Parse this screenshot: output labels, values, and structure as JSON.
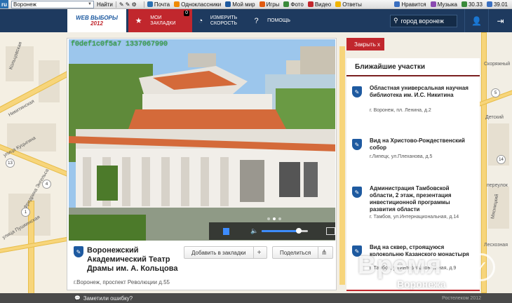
{
  "browser_toolbar": {
    "ru_label": "ru",
    "search_value": "Воронеж",
    "find_label": "Найти",
    "items": [
      {
        "label": "Почта",
        "icon": "mail-icon",
        "color": "#2a6fb0"
      },
      {
        "label": "Одноклассники",
        "icon": "ok-icon",
        "color": "#f08a00"
      },
      {
        "label": "Мой мир",
        "icon": "mymir-icon",
        "color": "#1e5aa0"
      },
      {
        "label": "Игры",
        "icon": "games-icon",
        "color": "#e05a10"
      },
      {
        "label": "Фото",
        "icon": "photo-icon",
        "color": "#3a8a3a"
      },
      {
        "label": "Видео",
        "icon": "video-icon",
        "color": "#c1272d"
      },
      {
        "label": "Ответы",
        "icon": "answers-icon",
        "color": "#f0b400"
      }
    ],
    "right_items": [
      {
        "label": "Нравится",
        "icon": "like-icon",
        "color": "#3a6fc0"
      },
      {
        "label": "Музыка",
        "icon": "music-icon",
        "color": "#8a4ab0"
      },
      {
        "label": "30.33",
        "icon": "dollar-icon",
        "color": "#3a8a3a"
      },
      {
        "label": "39.01",
        "icon": "euro-icon",
        "color": "#3a6fc0"
      }
    ]
  },
  "header": {
    "logo_line1": "WEB ВЫБОРЫ",
    "logo_line2": "2012",
    "bookmarks_label": "МОИ ЗАКЛАДКИ",
    "bookmarks_count": "0",
    "speed_label": "ИЗМЕРИТЬ СКОРОСТЬ",
    "help_label": "ПОМОЩЬ",
    "search_value": "город воронеж"
  },
  "video": {
    "camera_id": "f0def1c0f5a7 1337067990",
    "volume_level": 0.8
  },
  "place": {
    "title": "Воронежский Академический Театр Драмы им. А. Кольцова",
    "address": "г.Воронеж, проспект Революции д.55",
    "add_bookmark_label": "Добавить в закладки",
    "add_bookmark_icon": "+",
    "share_label": "Поделиться"
  },
  "side": {
    "close_label": "Закрыть  x",
    "heading": "Ближайшие участки",
    "items": [
      {
        "name": "Областная универсальная научная библиотека им. И.С. Никитина",
        "address": "г. Воронеж, пл. Ленина, д.2"
      },
      {
        "name": "Вид на Христово-Рождественский собор",
        "address": "г.Липецк, ул.Плеханова, д.5"
      },
      {
        "name": "Администрация Тамбовской области, 2 этаж, презентация инвестиционной программы развития области",
        "address": "г. Тамбов, ул.Интернациональная, д.14"
      },
      {
        "name": "Вид на сквер, строящуюся колокольню Казанского монастыря",
        "address": "г. Тамбов, ул.Интернациональная, д.9"
      }
    ]
  },
  "map_labels": [
    "Кольцовская",
    "Никитинская",
    "улица Куцыгина",
    "Фридриха Энгельса",
    "улица Пушкинская",
    "Скоряжный",
    "Детский",
    "Мясницкий",
    "переулок",
    "Лесхозная"
  ],
  "footer": {
    "feedback_label": "Заметили ошибку?",
    "copyright": "Ростелеком 2012"
  },
  "watermark": {
    "line1": "Время",
    "line2": "Воронежа"
  }
}
